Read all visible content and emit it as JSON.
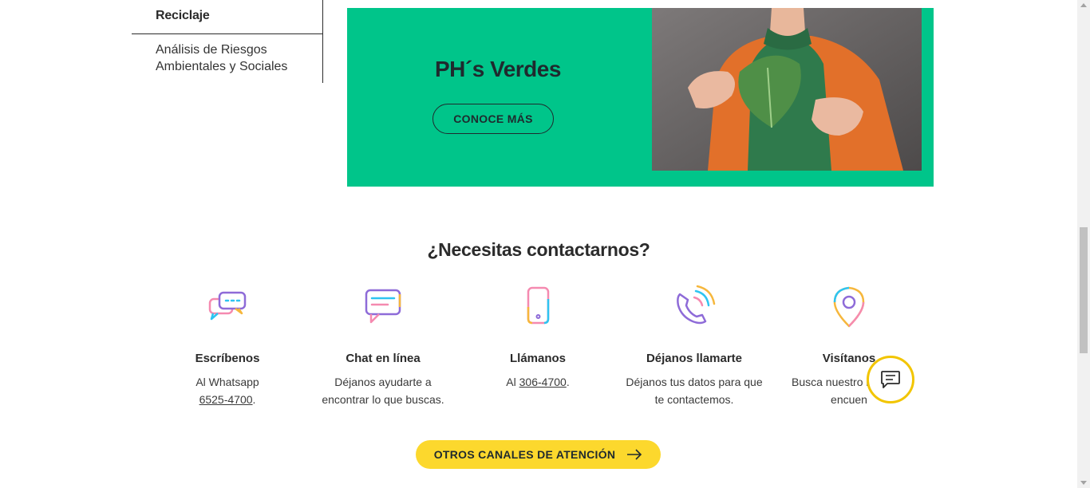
{
  "sidebar": {
    "items": [
      {
        "label": "Reciclaje"
      },
      {
        "label": "Análisis de Riesgos Ambientales y Sociales"
      }
    ]
  },
  "banner": {
    "title": "PH´s Verdes",
    "button_label": "CONOCE MÁS",
    "background_color": "#00c58a"
  },
  "contact": {
    "title": "¿Necesitas contactarnos?",
    "channels": [
      {
        "icon": "whatsapp-chat-icon",
        "name": "Escríbenos",
        "desc_prefix": "Al Whatsapp",
        "link": "6525-4700",
        "desc_suffix": "."
      },
      {
        "icon": "chat-bubble-icon",
        "name": "Chat en línea",
        "desc": "Déjanos ayudarte a encontrar lo que buscas."
      },
      {
        "icon": "phone-icon",
        "name": "Llámanos",
        "desc_prefix": "Al",
        "link": "306-4700",
        "desc_suffix": "."
      },
      {
        "icon": "callback-phone-icon",
        "name": "Déjanos llamarte",
        "desc": "Déjanos tus datos para que te contactemos."
      },
      {
        "icon": "location-pin-icon",
        "name": "Visítanos",
        "desc": "Busca nuestro lugar de encuen"
      }
    ],
    "cta_label": "OTROS CANALES DE ATENCIÓN",
    "cta_color": "#fcd82d"
  },
  "floating_chat": {
    "icon": "chat-icon",
    "border_color": "#f2c500"
  }
}
